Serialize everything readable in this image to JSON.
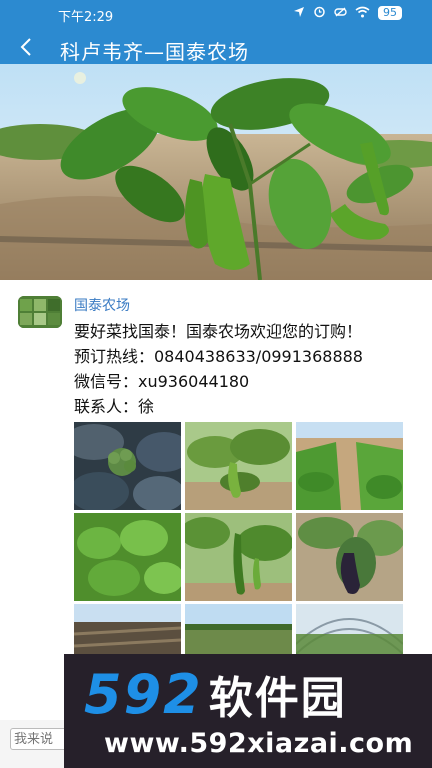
{
  "status_bar": {
    "time": "下午2:29",
    "battery": "95",
    "icons": [
      "location-arrow-icon",
      "alarm-icon",
      "mute-icon",
      "wifi-icon",
      "battery-icon"
    ]
  },
  "header": {
    "title": "科卢韦齐—国泰农场",
    "back_icon": "back-chevron-icon",
    "color": "#2c8ad0"
  },
  "post": {
    "author": "国泰农场",
    "lines": [
      "要好菜找国泰！国泰农场欢迎您的订购！",
      "预订热线：0840438633/0991368888",
      "微信号：xu936044180",
      "联系人：徐"
    ],
    "photo_count": 9
  },
  "comment": {
    "placeholder": "我来说"
  },
  "watermark": {
    "brand_number": "592",
    "brand_text": "软件园",
    "url": "www.592xiazai.com"
  }
}
